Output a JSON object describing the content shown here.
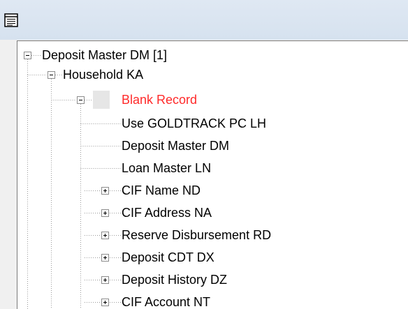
{
  "toolbar": {
    "icon": "document-icon"
  },
  "tree": {
    "root": {
      "label": "Deposit Master DM [1]",
      "expanded": true
    },
    "household": {
      "label": "Household KA",
      "expanded": true
    },
    "blank": {
      "label": "Blank Record",
      "expanded": true,
      "color": "#ff2a2a"
    },
    "children": [
      {
        "label": "Use GOLDTRACK PC LH",
        "expandable": false
      },
      {
        "label": "Deposit Master DM",
        "expandable": false
      },
      {
        "label": "Loan Master LN",
        "expandable": false
      },
      {
        "label": "CIF Name ND",
        "expandable": true
      },
      {
        "label": "CIF Address NA",
        "expandable": true
      },
      {
        "label": "Reserve Disbursement RD",
        "expandable": true
      },
      {
        "label": "Deposit CDT DX",
        "expandable": true
      },
      {
        "label": "Deposit History DZ",
        "expandable": true
      },
      {
        "label": "CIF Account NT",
        "expandable": true
      }
    ]
  }
}
